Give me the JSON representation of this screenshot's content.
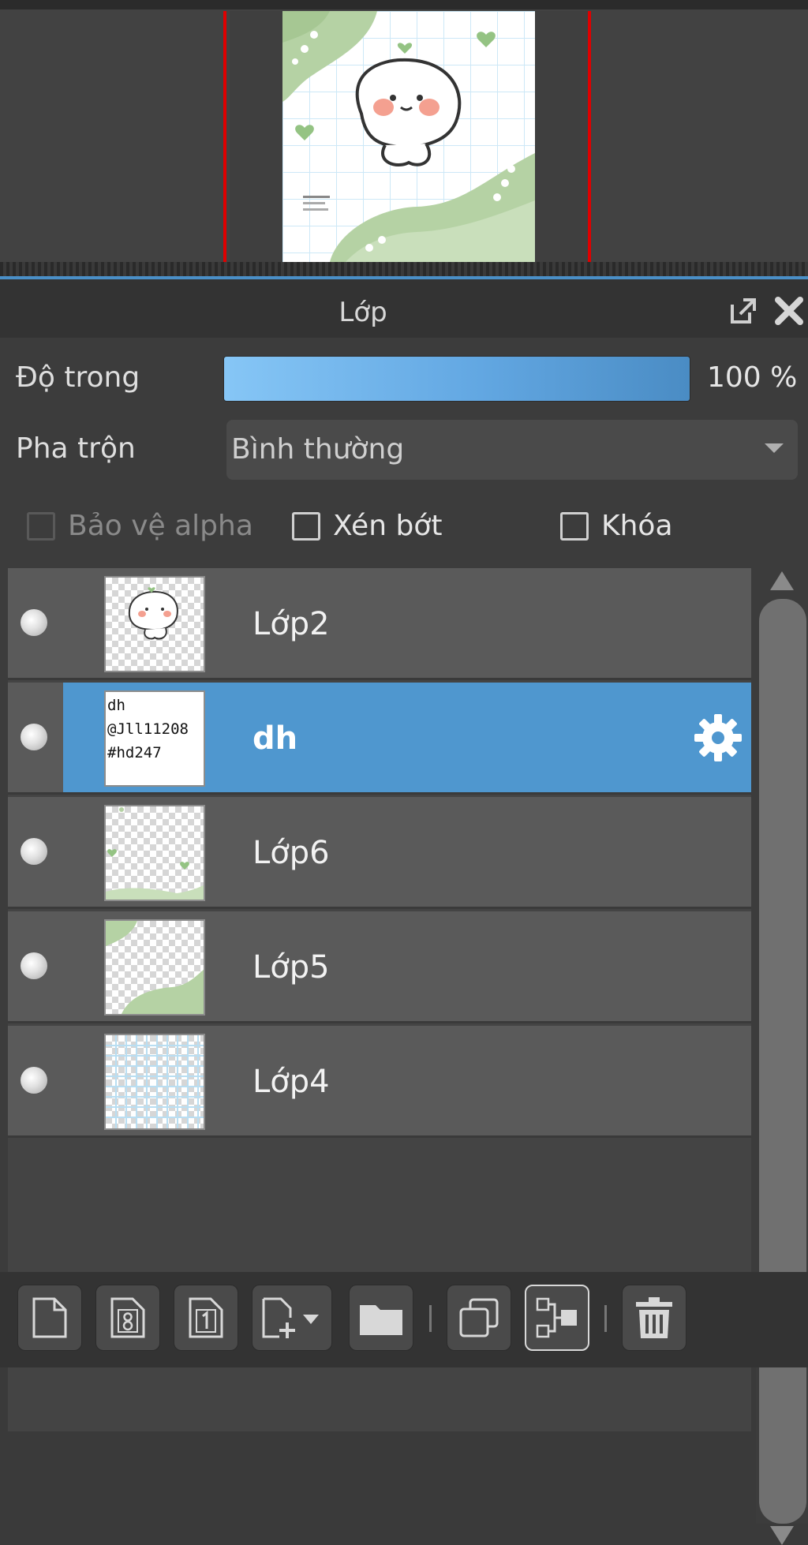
{
  "navigator": {
    "colors": {
      "frame": "#e00000",
      "green": "#b5d2a4",
      "grid": "#cde8f7"
    }
  },
  "panel": {
    "title": "Lớp",
    "header_icons": [
      "popout-icon",
      "close-icon"
    ],
    "opacity": {
      "label": "Độ trong",
      "value": "100 %",
      "level": 1.0
    },
    "blend": {
      "label": "Pha trộn",
      "value": "Bình thường"
    },
    "checkboxes": {
      "protect_alpha": {
        "label": "Bảo vệ alpha",
        "checked": false,
        "enabled": false
      },
      "clipping": {
        "label": "Xén bớt",
        "checked": false,
        "enabled": true
      },
      "lock": {
        "label": "Khóa",
        "checked": false,
        "enabled": true
      }
    }
  },
  "layers": [
    {
      "name": "Lớp2",
      "selected": false,
      "visible": true
    },
    {
      "name": "dh",
      "selected": true,
      "visible": true,
      "thumb_lines": [
        "dh",
        "@Jll11208",
        "#hd247"
      ]
    },
    {
      "name": "Lớp6",
      "selected": false,
      "visible": true
    },
    {
      "name": "Lớp5",
      "selected": false,
      "visible": true
    },
    {
      "name": "Lớp4",
      "selected": false,
      "visible": true
    }
  ],
  "toolbar": {
    "icons": [
      "new-layer-icon",
      "new-8bit-layer-icon",
      "new-1bit-layer-icon",
      "add-layer-menu-icon",
      "new-folder-icon",
      "duplicate-layer-icon",
      "merge-layer-icon",
      "delete-layer-icon"
    ],
    "accent": "#4f97cf"
  }
}
